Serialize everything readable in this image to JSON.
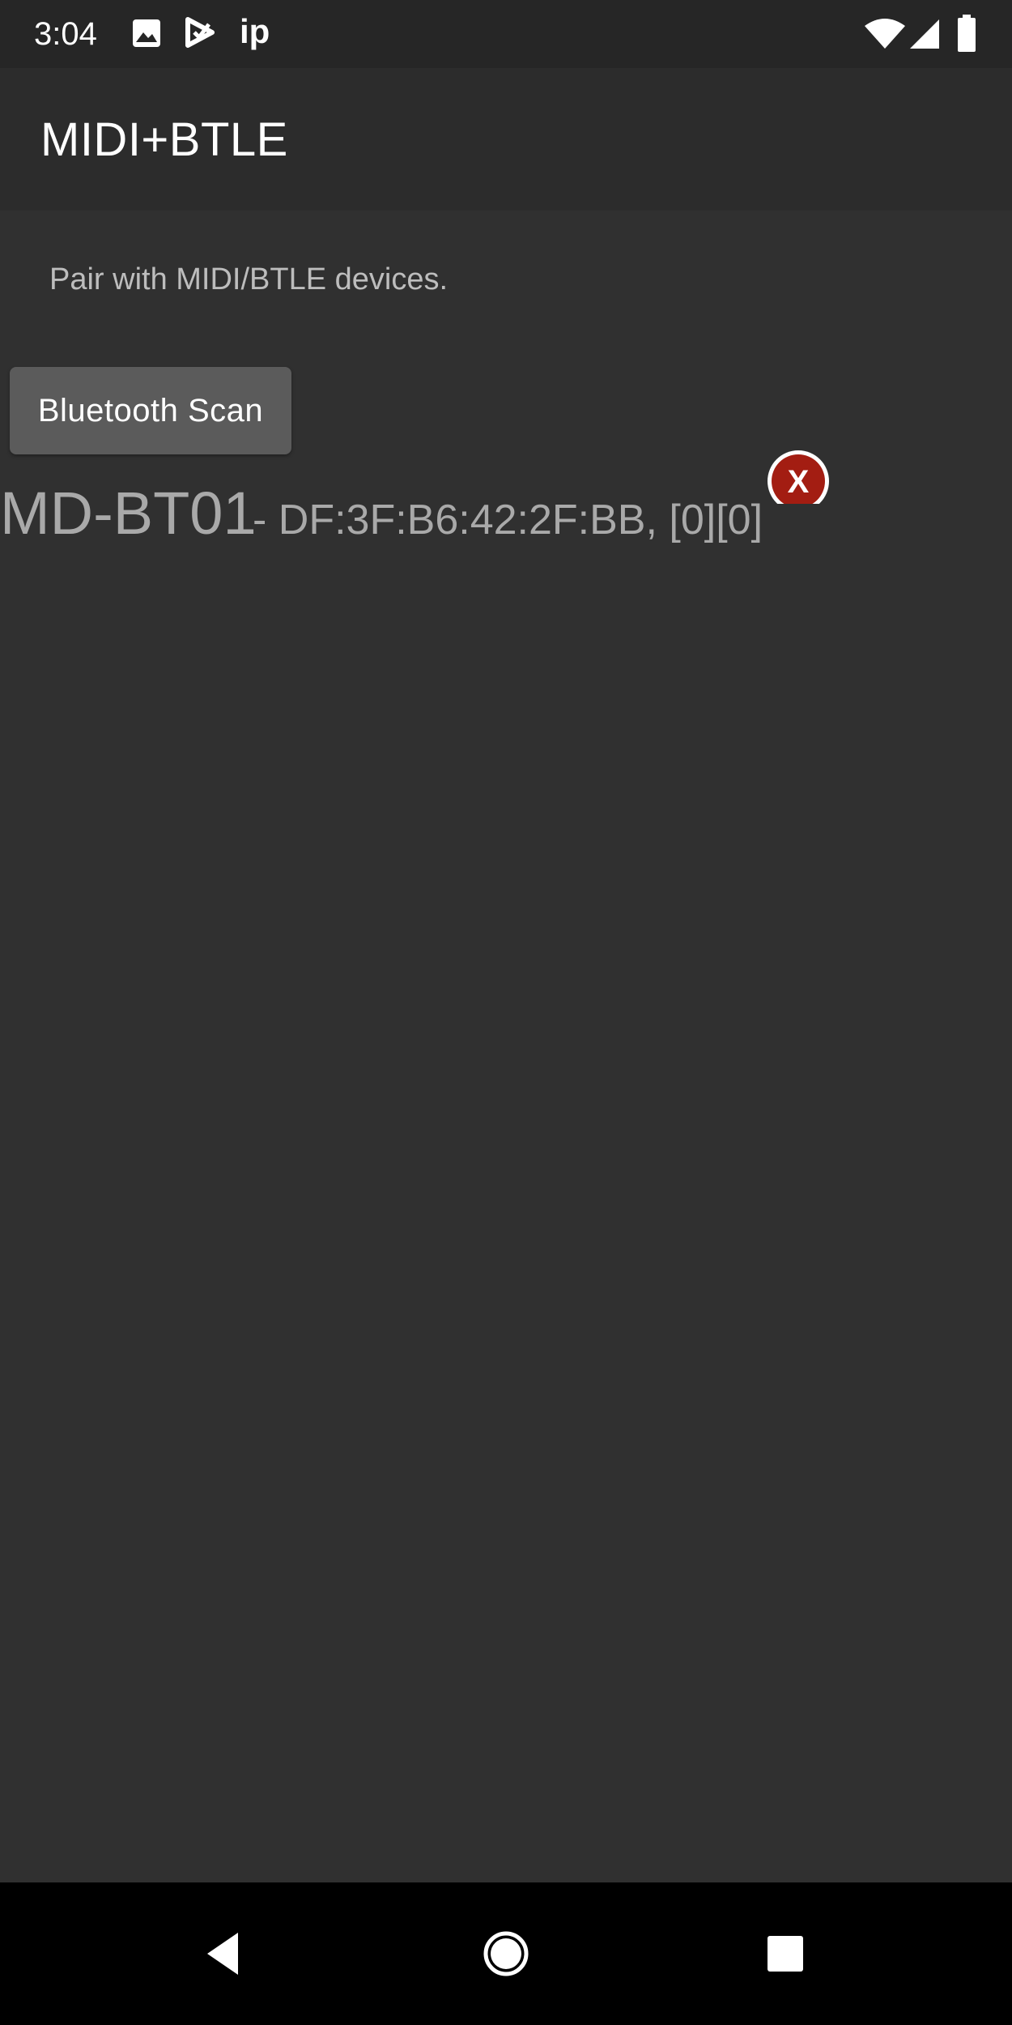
{
  "status_bar": {
    "time": "3:04",
    "notification_icons": [
      "image-icon",
      "play-store-icon",
      "ip-icon"
    ],
    "ip_label": "ip",
    "right_icons": [
      "wifi-icon",
      "signal-icon",
      "battery-icon"
    ]
  },
  "app_bar": {
    "title": "MIDI+BTLE"
  },
  "main": {
    "description": "Pair with MIDI/BTLE devices.",
    "scan_button_label": "Bluetooth Scan",
    "devices": [
      {
        "name": "MD-BT01",
        "detail": "- DF:3F:B6:42:2F:BB, [0][0]",
        "remove_icon": "close-icon",
        "remove_label": "X"
      }
    ]
  },
  "nav_bar": {
    "buttons": [
      "back-icon",
      "home-icon",
      "recents-icon"
    ]
  },
  "colors": {
    "background": "#303030",
    "app_bar": "#2c2c2c",
    "status_bar": "#262626",
    "button": "#5b5b5b",
    "device_text": "#a9a9a9",
    "remove_red": "#a31d12"
  }
}
